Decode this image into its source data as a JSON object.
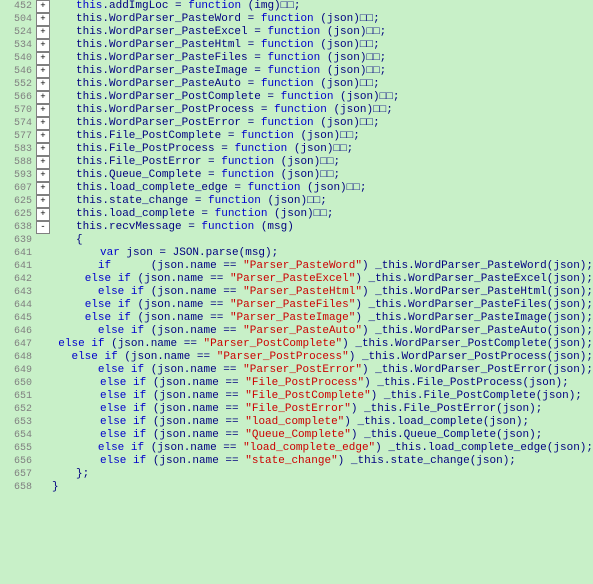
{
  "lines": [
    {
      "num": "452",
      "expand": "+",
      "indent": 4,
      "content": [
        {
          "t": "kw",
          "v": "this"
        },
        {
          "t": "n",
          "v": ".addImgLoc = "
        },
        {
          "t": "kw",
          "v": "function"
        },
        {
          "t": "n",
          "v": " (img)"
        },
        {
          "t": "n",
          "v": "▯▯;"
        }
      ]
    },
    {
      "num": "504",
      "expand": "+",
      "indent": 4,
      "content": [
        {
          "t": "n",
          "v": "this.WordParser_PasteWord = "
        },
        {
          "t": "kw",
          "v": "function"
        },
        {
          "t": "n",
          "v": " (json)"
        },
        {
          "t": "n",
          "v": "▯▯;"
        }
      ]
    },
    {
      "num": "524",
      "expand": "+",
      "indent": 4,
      "content": [
        {
          "t": "n",
          "v": "this.WordParser_PasteExcel = "
        },
        {
          "t": "kw",
          "v": "function"
        },
        {
          "t": "n",
          "v": " (json)"
        },
        {
          "t": "n",
          "v": "▯▯;"
        }
      ]
    },
    {
      "num": "534",
      "expand": "+",
      "indent": 4,
      "content": [
        {
          "t": "n",
          "v": "this.WordParser_PasteHtml = "
        },
        {
          "t": "kw",
          "v": "function"
        },
        {
          "t": "n",
          "v": " (json)"
        },
        {
          "t": "n",
          "v": "▯▯;"
        }
      ]
    },
    {
      "num": "540",
      "expand": "+",
      "indent": 4,
      "content": [
        {
          "t": "n",
          "v": "this.WordParser_PasteFiles = "
        },
        {
          "t": "kw",
          "v": "function"
        },
        {
          "t": "n",
          "v": " (json)"
        },
        {
          "t": "n",
          "v": "▯▯;"
        }
      ]
    },
    {
      "num": "546",
      "expand": "+",
      "indent": 4,
      "content": [
        {
          "t": "n",
          "v": "this.WordParser_PasteImage = "
        },
        {
          "t": "kw",
          "v": "function"
        },
        {
          "t": "n",
          "v": " (json)"
        },
        {
          "t": "n",
          "v": "▯▯;"
        }
      ]
    },
    {
      "num": "552",
      "expand": "+",
      "indent": 4,
      "content": [
        {
          "t": "n",
          "v": "this.WordParser_PasteAuto = "
        },
        {
          "t": "kw",
          "v": "function"
        },
        {
          "t": "n",
          "v": " (json)"
        },
        {
          "t": "n",
          "v": "▯▯;"
        }
      ]
    },
    {
      "num": "566",
      "expand": "+",
      "indent": 4,
      "content": [
        {
          "t": "n",
          "v": "this.WordParser_PostComplete = "
        },
        {
          "t": "kw",
          "v": "function"
        },
        {
          "t": "n",
          "v": " (json)"
        },
        {
          "t": "n",
          "v": "▯▯;"
        }
      ]
    },
    {
      "num": "570",
      "expand": "+",
      "indent": 4,
      "content": [
        {
          "t": "n",
          "v": "this.WordParser_PostProcess = "
        },
        {
          "t": "kw",
          "v": "function"
        },
        {
          "t": "n",
          "v": " (json)"
        },
        {
          "t": "n",
          "v": "▯▯;"
        }
      ]
    },
    {
      "num": "574",
      "expand": "+",
      "indent": 4,
      "content": [
        {
          "t": "n",
          "v": "this.WordParser_PostError = "
        },
        {
          "t": "kw",
          "v": "function"
        },
        {
          "t": "n",
          "v": " (json)"
        },
        {
          "t": "n",
          "v": "▯▯;"
        }
      ]
    },
    {
      "num": "577",
      "expand": "+",
      "indent": 4,
      "content": [
        {
          "t": "n",
          "v": "this.File_PostComplete = "
        },
        {
          "t": "kw",
          "v": "function"
        },
        {
          "t": "n",
          "v": " (json)"
        },
        {
          "t": "n",
          "v": "▯▯;"
        }
      ]
    },
    {
      "num": "583",
      "expand": "+",
      "indent": 4,
      "content": [
        {
          "t": "n",
          "v": "this.File_PostProcess = "
        },
        {
          "t": "kw",
          "v": "function"
        },
        {
          "t": "n",
          "v": " (json)"
        },
        {
          "t": "n",
          "v": "▯▯;"
        }
      ]
    },
    {
      "num": "588",
      "expand": "+",
      "indent": 4,
      "content": [
        {
          "t": "n",
          "v": "this.File_PostError = "
        },
        {
          "t": "kw",
          "v": "function"
        },
        {
          "t": "n",
          "v": " (json)"
        },
        {
          "t": "n",
          "v": "▯▯;"
        }
      ]
    },
    {
      "num": "593",
      "expand": "+",
      "indent": 4,
      "content": [
        {
          "t": "n",
          "v": "this.Queue_Complete = "
        },
        {
          "t": "kw",
          "v": "function"
        },
        {
          "t": "n",
          "v": " (json)"
        },
        {
          "t": "n",
          "v": "▯▯;"
        }
      ]
    },
    {
      "num": "607",
      "expand": "+",
      "indent": 4,
      "content": [
        {
          "t": "n",
          "v": "this.load_complete_edge = "
        },
        {
          "t": "kw",
          "v": "function"
        },
        {
          "t": "n",
          "v": " (json)"
        },
        {
          "t": "n",
          "v": "▯▯;"
        }
      ]
    },
    {
      "num": "625",
      "expand": "+",
      "indent": 4,
      "content": [
        {
          "t": "n",
          "v": "this.state_change = "
        },
        {
          "t": "kw",
          "v": "function"
        },
        {
          "t": "n",
          "v": " (json)"
        },
        {
          "t": "n",
          "v": "▯▯;"
        }
      ]
    },
    {
      "num": "625",
      "expand": "+",
      "indent": 4,
      "content": [
        {
          "t": "n",
          "v": "this.load_complete = "
        },
        {
          "t": "kw",
          "v": "function"
        },
        {
          "t": "n",
          "v": " (json)"
        },
        {
          "t": "n",
          "v": "▯▯;"
        }
      ]
    },
    {
      "num": "638",
      "expand": "-",
      "indent": 4,
      "content": [
        {
          "t": "n",
          "v": "this.recvMessage = "
        },
        {
          "t": "kw",
          "v": "function"
        },
        {
          "t": "n",
          "v": " (msg)"
        }
      ]
    },
    {
      "num": "639",
      "expand": "none",
      "indent": 4,
      "content": [
        {
          "t": "n",
          "v": "{"
        }
      ]
    },
    {
      "num": "641",
      "expand": "none",
      "indent": 8,
      "content": [
        {
          "t": "kw",
          "v": "var"
        },
        {
          "t": "n",
          "v": " json = JSON.parse(msg);"
        }
      ]
    },
    {
      "num": "641",
      "expand": "none",
      "indent": 8,
      "content": [
        {
          "t": "kw",
          "v": "if"
        },
        {
          "t": "n",
          "v": "      (json.name == "
        },
        {
          "t": "str",
          "v": "\"Parser_PasteWord\""
        },
        {
          "t": "n",
          "v": ") _this.WordParser_PasteWord(json);"
        }
      ]
    },
    {
      "num": "642",
      "expand": "none",
      "indent": 8,
      "content": [
        {
          "t": "kw",
          "v": "else if"
        },
        {
          "t": "n",
          "v": " (json.name == "
        },
        {
          "t": "str",
          "v": "\"Parser_PasteExcel\""
        },
        {
          "t": "n",
          "v": ") _this.WordParser_PasteExcel(json);"
        }
      ]
    },
    {
      "num": "643",
      "expand": "none",
      "indent": 8,
      "content": [
        {
          "t": "kw",
          "v": "else if"
        },
        {
          "t": "n",
          "v": " (json.name == "
        },
        {
          "t": "str",
          "v": "\"Parser_PasteHtml\""
        },
        {
          "t": "n",
          "v": ") _this.WordParser_PasteHtml(json);"
        }
      ]
    },
    {
      "num": "644",
      "expand": "none",
      "indent": 8,
      "content": [
        {
          "t": "kw",
          "v": "else if"
        },
        {
          "t": "n",
          "v": " (json.name == "
        },
        {
          "t": "str",
          "v": "\"Parser_PasteFiles\""
        },
        {
          "t": "n",
          "v": ") _this.WordParser_PasteFiles(json);"
        }
      ]
    },
    {
      "num": "645",
      "expand": "none",
      "indent": 8,
      "content": [
        {
          "t": "kw",
          "v": "else if"
        },
        {
          "t": "n",
          "v": " (json.name == "
        },
        {
          "t": "str",
          "v": "\"Parser_PasteImage\""
        },
        {
          "t": "n",
          "v": ") _this.WordParser_PasteImage(json);"
        }
      ]
    },
    {
      "num": "646",
      "expand": "none",
      "indent": 8,
      "content": [
        {
          "t": "kw",
          "v": "else if"
        },
        {
          "t": "n",
          "v": " (json.name == "
        },
        {
          "t": "str",
          "v": "\"Parser_PasteAuto\""
        },
        {
          "t": "n",
          "v": ") _this.WordParser_PasteAuto(json);"
        }
      ]
    },
    {
      "num": "647",
      "expand": "none",
      "indent": 8,
      "content": [
        {
          "t": "kw",
          "v": "else if"
        },
        {
          "t": "n",
          "v": " (json.name == "
        },
        {
          "t": "str",
          "v": "\"Parser_PostComplete\""
        },
        {
          "t": "n",
          "v": ") _this.WordParser_PostComplete(json);"
        }
      ]
    },
    {
      "num": "648",
      "expand": "none",
      "indent": 8,
      "content": [
        {
          "t": "kw",
          "v": "else if"
        },
        {
          "t": "n",
          "v": " (json.name == "
        },
        {
          "t": "str",
          "v": "\"Parser_PostProcess\""
        },
        {
          "t": "n",
          "v": ") _this.WordParser_PostProcess(json);"
        }
      ]
    },
    {
      "num": "649",
      "expand": "none",
      "indent": 8,
      "content": [
        {
          "t": "kw",
          "v": "else if"
        },
        {
          "t": "n",
          "v": " (json.name == "
        },
        {
          "t": "str",
          "v": "\"Parser_PostError\""
        },
        {
          "t": "n",
          "v": ") _this.WordParser_PostError(json);"
        }
      ]
    },
    {
      "num": "650",
      "expand": "none",
      "indent": 8,
      "content": [
        {
          "t": "kw",
          "v": "else if"
        },
        {
          "t": "n",
          "v": " (json.name == "
        },
        {
          "t": "str",
          "v": "\"File_PostProcess\""
        },
        {
          "t": "n",
          "v": ") _this.File_PostProcess(json);"
        }
      ]
    },
    {
      "num": "651",
      "expand": "none",
      "indent": 8,
      "content": [
        {
          "t": "kw",
          "v": "else if"
        },
        {
          "t": "n",
          "v": " (json.name == "
        },
        {
          "t": "str",
          "v": "\"File_PostComplete\""
        },
        {
          "t": "n",
          "v": ") _this.File_PostComplete(json);"
        }
      ]
    },
    {
      "num": "652",
      "expand": "none",
      "indent": 8,
      "content": [
        {
          "t": "kw",
          "v": "else if"
        },
        {
          "t": "n",
          "v": " (json.name == "
        },
        {
          "t": "str",
          "v": "\"File_PostError\""
        },
        {
          "t": "n",
          "v": ") _this.File_PostError(json);"
        }
      ]
    },
    {
      "num": "653",
      "expand": "none",
      "indent": 8,
      "content": [
        {
          "t": "kw",
          "v": "else if"
        },
        {
          "t": "n",
          "v": " (json.name == "
        },
        {
          "t": "str",
          "v": "\"load_complete\""
        },
        {
          "t": "n",
          "v": ") _this.load_complete(json);"
        }
      ]
    },
    {
      "num": "654",
      "expand": "none",
      "indent": 8,
      "content": [
        {
          "t": "kw",
          "v": "else if"
        },
        {
          "t": "n",
          "v": " (json.name == "
        },
        {
          "t": "str",
          "v": "\"Queue_Complete\""
        },
        {
          "t": "n",
          "v": ") _this.Queue_Complete(json);"
        }
      ]
    },
    {
      "num": "655",
      "expand": "none",
      "indent": 8,
      "content": [
        {
          "t": "kw",
          "v": "else if"
        },
        {
          "t": "n",
          "v": " (json.name == "
        },
        {
          "t": "str",
          "v": "\"load_complete_edge\""
        },
        {
          "t": "n",
          "v": ") _this.load_complete_edge(json);"
        }
      ]
    },
    {
      "num": "656",
      "expand": "none",
      "indent": 8,
      "content": [
        {
          "t": "kw",
          "v": "else if"
        },
        {
          "t": "n",
          "v": " (json.name == "
        },
        {
          "t": "str",
          "v": "\"state_change\""
        },
        {
          "t": "n",
          "v": ") _this.state_change(json);"
        }
      ]
    },
    {
      "num": "657",
      "expand": "none",
      "indent": 4,
      "content": [
        {
          "t": "n",
          "v": "};"
        }
      ]
    },
    {
      "num": "658",
      "expand": "none",
      "indent": 0,
      "content": [
        {
          "t": "n",
          "v": "}"
        }
      ]
    }
  ]
}
